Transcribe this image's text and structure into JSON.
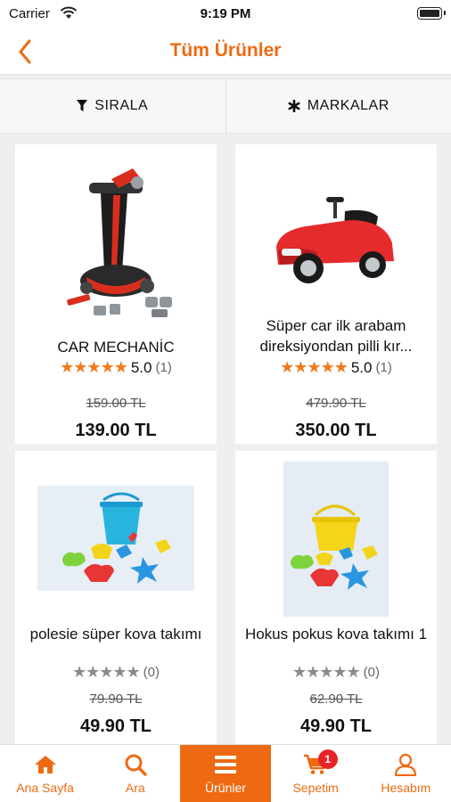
{
  "status_bar": {
    "carrier": "Carrier",
    "time": "9:19 PM"
  },
  "nav": {
    "title": "Tüm Ürünler"
  },
  "filters": {
    "sort_label": "SIRALA",
    "brands_label": "MARKALAR"
  },
  "products": [
    {
      "name": "CAR MECHANİC",
      "stars": "★★★★★",
      "rating": "5.0",
      "reviews": "(1)",
      "old_price": "159.00 TL",
      "price": "139.00 TL",
      "image_icon": "car-mechanic-toy"
    },
    {
      "name": "Süper car ilk arabam direksiyondan pilli kır...",
      "stars": "★★★★★",
      "rating": "5.0",
      "reviews": "(1)",
      "old_price": "479.90 TL",
      "price": "350.00 TL",
      "image_icon": "red-ride-on-car"
    },
    {
      "name": "polesie süper kova takımı",
      "stars": "★★★★★",
      "rating": "",
      "reviews": "(0)",
      "old_price": "79.90 TL",
      "price": "49.90 TL",
      "image_icon": "blue-bucket-set"
    },
    {
      "name": "Hokus pokus kova takımı 1",
      "stars": "★★★★★",
      "rating": "",
      "reviews": "(0)",
      "old_price": "62.90 TL",
      "price": "49.90 TL",
      "image_icon": "yellow-bucket-set"
    }
  ],
  "tabs": [
    {
      "label": "Ana Sayfa",
      "icon": "home-icon"
    },
    {
      "label": "Ara",
      "icon": "search-icon"
    },
    {
      "label": "Ürünler",
      "icon": "menu-icon"
    },
    {
      "label": "Sepetim",
      "icon": "cart-icon",
      "badge": "1"
    },
    {
      "label": "Hesabım",
      "icon": "user-icon"
    }
  ],
  "colors": {
    "accent": "#ee6a12",
    "star_filled": "#f07a1c",
    "star_empty": "#8a8a8a",
    "badge": "#e52429"
  }
}
